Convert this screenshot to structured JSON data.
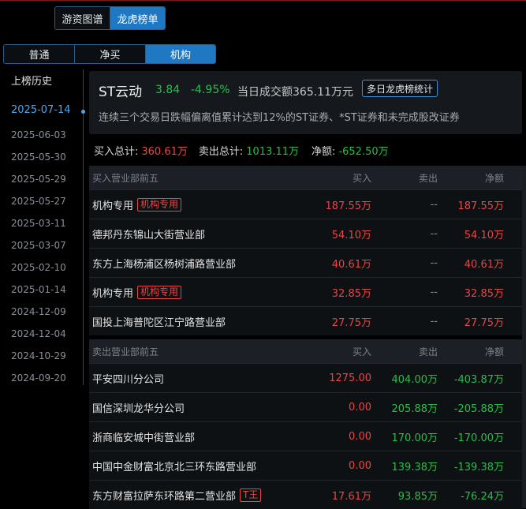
{
  "tabs_top": [
    "游资图谱",
    "龙虎榜单"
  ],
  "tabs_top_active": 1,
  "tabs_mode": [
    "普通",
    "净买",
    "机构"
  ],
  "tabs_mode_active": 2,
  "sidebar": {
    "title": "上榜历史",
    "dates": [
      "2025-07-14",
      "2025-06-03",
      "2025-05-30",
      "2025-05-29",
      "2025-05-27",
      "2025-03-11",
      "2025-03-07",
      "2025-02-10",
      "2025-01-14",
      "2024-12-09",
      "2024-12-04",
      "2024-10-29",
      "2024-09-20"
    ],
    "active_index": 0
  },
  "stock": {
    "name": "ST云动",
    "price": "3.84",
    "change": "-4.95%",
    "turnover": "当日成交额365.11万元",
    "multi_button": "多日龙虎榜统计",
    "reason": "连续三个交易日跌幅偏离值累计达到12%的ST证券、*ST证券和未完成股改证券"
  },
  "totals": {
    "buy_label": "买入总计:",
    "buy_value": "360.61万",
    "sell_label": "卖出总计:",
    "sell_value": "1013.11万",
    "net_label": "净额:",
    "net_value": "-652.50万"
  },
  "colors": {
    "up": "#e84545",
    "down": "#2bbd4a",
    "accent": "#1f78c1"
  },
  "buy_table": {
    "headers": [
      "买入营业部前五",
      "买入",
      "卖出",
      "净额"
    ],
    "rows": [
      {
        "name": "机构专用",
        "tag": "机构专用",
        "buy": "187.55万",
        "sell": "--",
        "net": "187.55万"
      },
      {
        "name": "德邦丹东锦山大街营业部",
        "tag": "",
        "buy": "54.10万",
        "sell": "--",
        "net": "54.10万"
      },
      {
        "name": "东方上海杨浦区杨树浦路营业部",
        "tag": "",
        "buy": "40.61万",
        "sell": "--",
        "net": "40.61万"
      },
      {
        "name": "机构专用",
        "tag": "机构专用",
        "buy": "32.85万",
        "sell": "--",
        "net": "32.85万"
      },
      {
        "name": "国投上海普陀区江宁路营业部",
        "tag": "",
        "buy": "27.75万",
        "sell": "--",
        "net": "27.75万"
      }
    ]
  },
  "sell_table": {
    "headers": [
      "卖出营业部前五",
      "买入",
      "卖出",
      "净额"
    ],
    "rows": [
      {
        "name": "平安四川分公司",
        "tag": "",
        "buy": "1275.00",
        "sell": "404.00万",
        "net": "-403.87万"
      },
      {
        "name": "国信深圳龙华分公司",
        "tag": "",
        "buy": "0.00",
        "sell": "205.88万",
        "net": "-205.88万"
      },
      {
        "name": "浙商临安城中街营业部",
        "tag": "",
        "buy": "0.00",
        "sell": "170.00万",
        "net": "-170.00万"
      },
      {
        "name": "中国中金财富北京北三环东路营业部",
        "tag": "",
        "buy": "0.00",
        "sell": "139.38万",
        "net": "-139.38万"
      },
      {
        "name": "东方财富拉萨东环路第二营业部",
        "tag": "T王",
        "buy": "17.61万",
        "sell": "93.85万",
        "net": "-76.24万"
      }
    ]
  }
}
